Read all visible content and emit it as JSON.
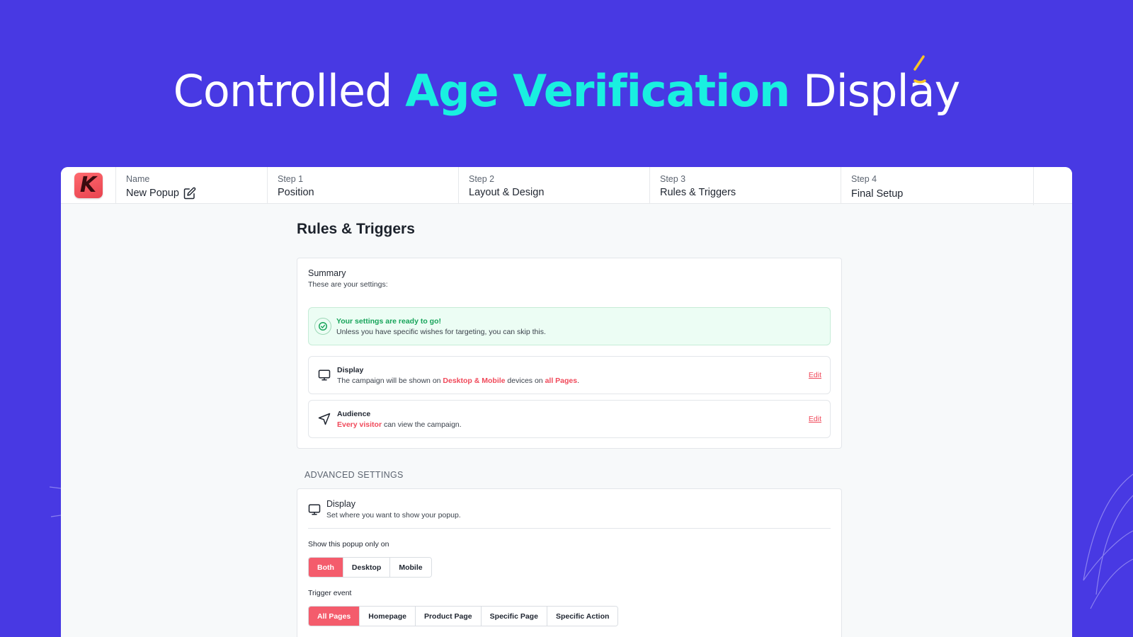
{
  "hero": {
    "title_pre": "Controlled",
    "title_accent": "Age Verification",
    "title_post": "Display"
  },
  "colors": {
    "background": "#4839e3",
    "accent": "#19f0e0",
    "brand": "#f45c6c",
    "success": "#17a45a"
  },
  "app": {
    "logo_letter": "K",
    "name_step": {
      "label": "Name",
      "value": "New Popup"
    },
    "steps": [
      {
        "label": "Step 1",
        "title": "Position"
      },
      {
        "label": "Step 2",
        "title": "Layout & Design"
      },
      {
        "label": "Step 3",
        "title": "Rules & Triggers"
      },
      {
        "label": "Step 4",
        "title": "Final Setup"
      }
    ],
    "page_title": "Rules & Triggers",
    "summary": {
      "title": "Summary",
      "subtitle": "These are your settings:",
      "success_title": "Your settings are ready to go!",
      "success_text": "Unless you have specific wishes for targeting, you can skip this.",
      "display": {
        "title": "Display",
        "text_1": "The campaign will be shown on ",
        "hl_1": "Desktop & Mobile",
        "text_2": " devices on ",
        "hl_2": "all Pages",
        "text_3": ".",
        "edit": "Edit"
      },
      "audience": {
        "title": "Audience",
        "hl_1": "Every visitor",
        "text_1": " can view the campaign.",
        "edit": "Edit"
      }
    },
    "advanced": {
      "label": "ADVANCED SETTINGS",
      "display_title": "Display",
      "display_sub": "Set where you want to show your popup.",
      "device_label": "Show this popup only on",
      "device_options": [
        "Both",
        "Desktop",
        "Mobile"
      ],
      "device_selected": "Both",
      "trigger_label": "Trigger event",
      "trigger_options": [
        "All Pages",
        "Homepage",
        "Product Page",
        "Specific Page",
        "Specific Action"
      ],
      "trigger_selected": "All Pages"
    }
  }
}
